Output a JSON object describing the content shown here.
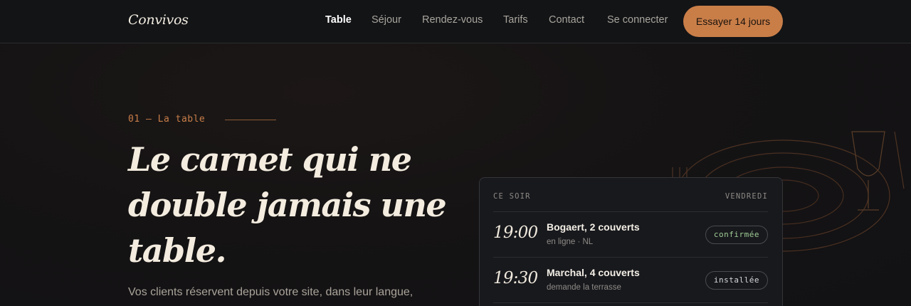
{
  "brand": {
    "logo": "Convivos"
  },
  "nav": {
    "links": [
      "Table",
      "Séjour",
      "Rendez-vous",
      "Tarifs",
      "Contact",
      "Se connecter"
    ],
    "active": "Table",
    "cta": "Essayer 14 jours"
  },
  "hero": {
    "eyebrow": "01 — La table",
    "headline": "Le carnet qui ne double jamais une table.",
    "lede": "Vos clients réservent depuis votre site, dans leur langue,"
  },
  "card": {
    "label_left": "CE SOIR",
    "label_right": "VENDREDI",
    "reservations": [
      {
        "time": "19:00",
        "name": "Bogaert, 2 couverts",
        "detail": "en ligne · NL",
        "status": "confirmée"
      },
      {
        "time": "19:30",
        "name": "Marchal, 4 couverts",
        "detail": "demande la terrasse",
        "status": "installée"
      }
    ]
  },
  "colors": {
    "accent": "#c97e48",
    "confirmed": "#9fcc94",
    "background": "#141214"
  }
}
